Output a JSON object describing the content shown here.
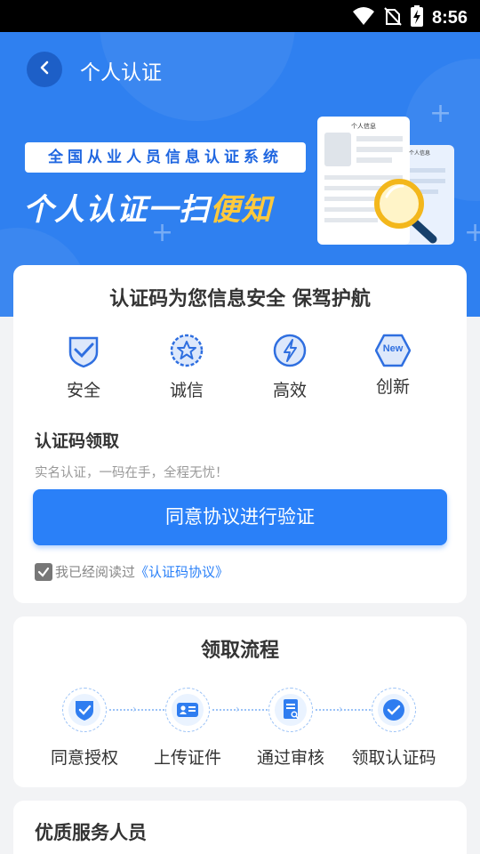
{
  "status_bar": {
    "time": "8:56"
  },
  "header": {
    "title": "个人认证"
  },
  "banner": {
    "system_label": "全国从业人员信息认证系统",
    "slogan_white": "个人认证一扫",
    "slogan_yellow": "便知",
    "doc_front_title": "个人信息",
    "doc_back_title": "个人信息"
  },
  "intro_card": {
    "title": "认证码为您信息安全 保驾护航",
    "features": [
      {
        "label": "安全",
        "icon": "shield-check-icon"
      },
      {
        "label": "诚信",
        "icon": "star-badge-icon"
      },
      {
        "label": "高效",
        "icon": "lightning-icon"
      },
      {
        "label": "创新",
        "icon": "new-badge-icon",
        "badge_text": "New"
      }
    ],
    "section_title": "认证码领取",
    "section_subtitle": "实名认证，一码在手，全程无忧！",
    "agree_button": "同意协议进行验证",
    "consent_text": "我已经阅读过",
    "consent_link": "《认证码协议》",
    "consent_checked": true
  },
  "process_card": {
    "title": "领取流程",
    "steps": [
      {
        "label": "同意授权",
        "icon": "shield-check-icon"
      },
      {
        "label": "上传证件",
        "icon": "id-card-icon"
      },
      {
        "label": "通过审核",
        "icon": "document-review-icon"
      },
      {
        "label": "领取认证码",
        "icon": "check-circle-icon"
      }
    ]
  },
  "service_card": {
    "title": "优质服务人员"
  },
  "colors": {
    "primary": "#2a80f8",
    "banner": "#2f80f0",
    "accent_yellow": "#ffc93c"
  }
}
